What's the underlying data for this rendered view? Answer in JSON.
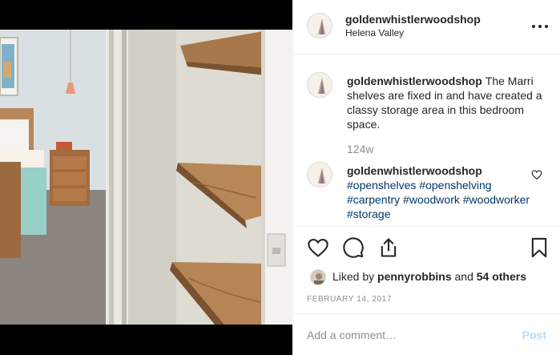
{
  "post": {
    "author": "goldenwhistlerwoodshop",
    "location": "Helena Valley",
    "image_alt": "Marri timber open shelves in a bedroom alcove",
    "caption_text": "The Marri shelves are fixed in and have created a classy storage area in this bedroom space.",
    "caption_time": "124w",
    "comment": {
      "author": "goldenwhistlerwoodshop",
      "hashtags": [
        "#openshelves",
        "#openshelving",
        "#carpentry",
        "#woodwork",
        "#woodworker",
        "#storage"
      ]
    },
    "likes": {
      "prefix": "Liked by",
      "user": "pennyrobbins",
      "joiner": "and",
      "others": "54 others"
    },
    "date": "FEBRUARY 14, 2017"
  },
  "comment_box": {
    "placeholder": "Add a comment…",
    "post_label": "Post"
  },
  "colors": {
    "link": "#00376b",
    "post_disabled": "#b3dbff",
    "muted": "#8e8e8e"
  },
  "icons": [
    "more-icon",
    "heart-icon",
    "comment-icon",
    "share-icon",
    "bookmark-icon",
    "small-heart-icon"
  ]
}
